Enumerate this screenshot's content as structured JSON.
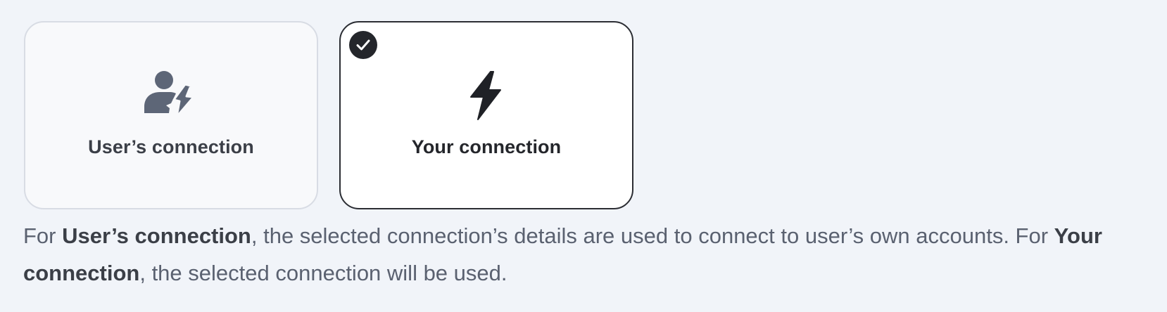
{
  "options": [
    {
      "label": "User’s connection",
      "icon": "user-bolt-icon",
      "selected": false
    },
    {
      "label": "Your connection",
      "icon": "lightning-bolt-icon",
      "selected": true
    }
  ],
  "selected_indicator_icon": "checkmark-icon",
  "description": {
    "prefix_1": "For ",
    "bold_1": "User’s connection",
    "middle": ", the selected connection’s details are used to connect to user’s own accounts. For ",
    "bold_2": "Your connection",
    "suffix": ", the selected connection will be used."
  },
  "colors": {
    "background": "#f1f4f9",
    "selected_border": "#2b2d33",
    "unselected_border": "#d8dce4",
    "icon_unselected": "#5d6677",
    "icon_selected": "#1f2126"
  }
}
